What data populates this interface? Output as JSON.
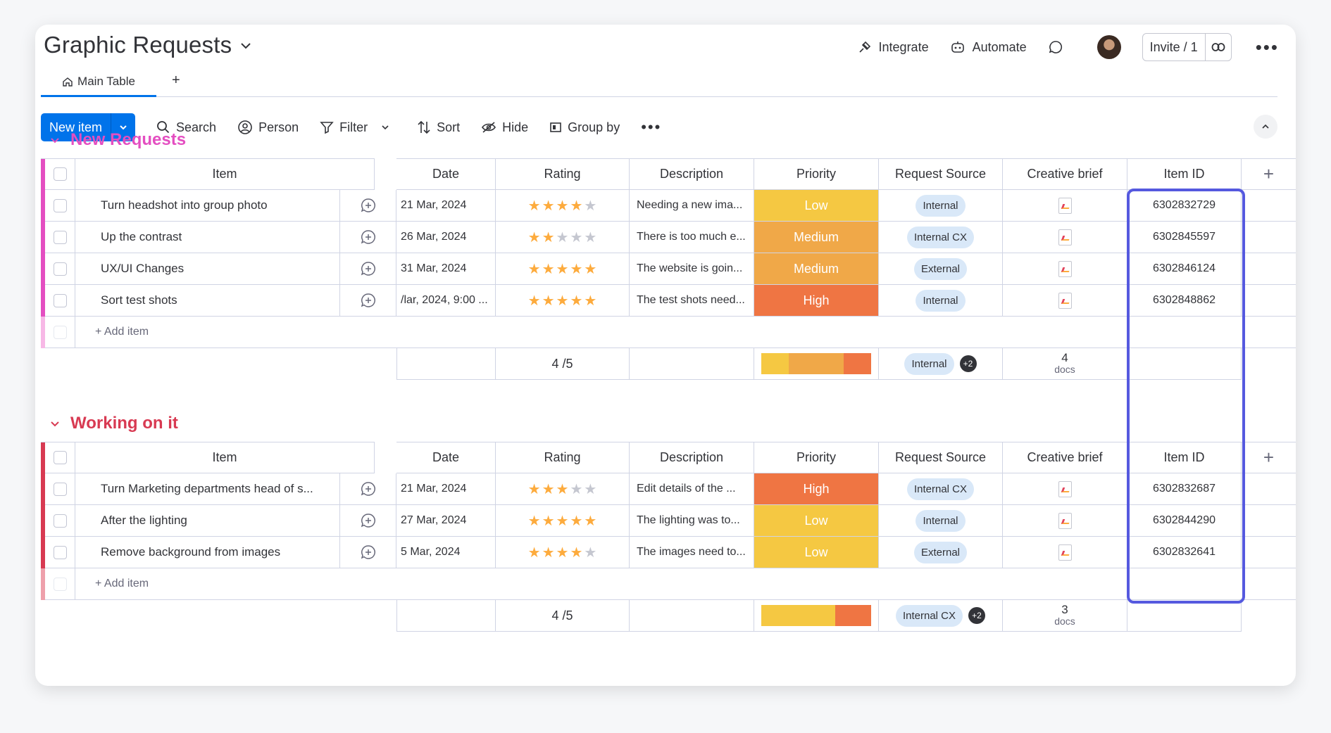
{
  "board": {
    "title": "Graphic Requests"
  },
  "topbar": {
    "integrate": "Integrate",
    "automate": "Automate",
    "invite": "Invite / 1"
  },
  "tabs": [
    {
      "label": "Main Table"
    }
  ],
  "toolbar": {
    "new_item": "New item",
    "search": "Search",
    "person": "Person",
    "filter": "Filter",
    "sort": "Sort",
    "hide": "Hide",
    "group_by": "Group by"
  },
  "columns": {
    "item": "Item",
    "date": "Date",
    "rating": "Rating",
    "description": "Description",
    "priority": "Priority",
    "source": "Request Source",
    "brief": "Creative brief",
    "item_id": "Item ID"
  },
  "colors": {
    "accent": "#0073ea",
    "group1": "#e44ec1",
    "group2": "#d83a52",
    "low": "#f5c842",
    "medium": "#f0a848",
    "high": "#ef7543",
    "highlight": "#5559df"
  },
  "groups": [
    {
      "title": "New Requests",
      "add_item": "+ Add item",
      "rows": [
        {
          "item": "Turn headshot into group photo",
          "date": "21 Mar, 2024",
          "rating": 4,
          "description": "Needing a new ima...",
          "priority": "Low",
          "source": "Internal",
          "item_id": "6302832729"
        },
        {
          "item": "Up the contrast",
          "date": "26 Mar, 2024",
          "rating": 2,
          "description": "There is too much e...",
          "priority": "Medium",
          "source": "Internal CX",
          "item_id": "6302845597"
        },
        {
          "item": "UX/UI Changes",
          "date": "31 Mar, 2024",
          "rating": 5,
          "description": "The website is goin...",
          "priority": "Medium",
          "source": "External",
          "item_id": "6302846124"
        },
        {
          "item": "Sort test shots",
          "date": "/lar, 2024, 9:00 ...",
          "rating": 5,
          "description": "The test shots need...",
          "priority": "High",
          "source": "Internal",
          "item_id": "6302848862"
        }
      ],
      "summary": {
        "rating": "4 /5",
        "source": "Internal",
        "source_more": "+2",
        "docs_count": "4",
        "docs_label": "docs",
        "priority_dist": [
          0.25,
          0.5,
          0.25
        ]
      }
    },
    {
      "title": "Working on it",
      "add_item": "+ Add item",
      "rows": [
        {
          "item": "Turn Marketing departments head of s...",
          "date": "21 Mar, 2024",
          "rating": 3,
          "description": "Edit details of the ...",
          "priority": "High",
          "source": "Internal CX",
          "item_id": "6302832687"
        },
        {
          "item": "After the lighting",
          "date": "27 Mar, 2024",
          "rating": 5,
          "description": "The lighting was to...",
          "priority": "Low",
          "source": "Internal",
          "item_id": "6302844290"
        },
        {
          "item": "Remove background from images",
          "date": "5 Mar, 2024",
          "rating": 4,
          "description": "The images need to...",
          "priority": "Low",
          "source": "External",
          "item_id": "6302832641"
        }
      ],
      "summary": {
        "rating": "4 /5",
        "source": "Internal CX",
        "source_more": "+2",
        "docs_count": "3",
        "docs_label": "docs",
        "priority_dist": [
          0.67,
          0.0,
          0.33
        ]
      }
    }
  ]
}
